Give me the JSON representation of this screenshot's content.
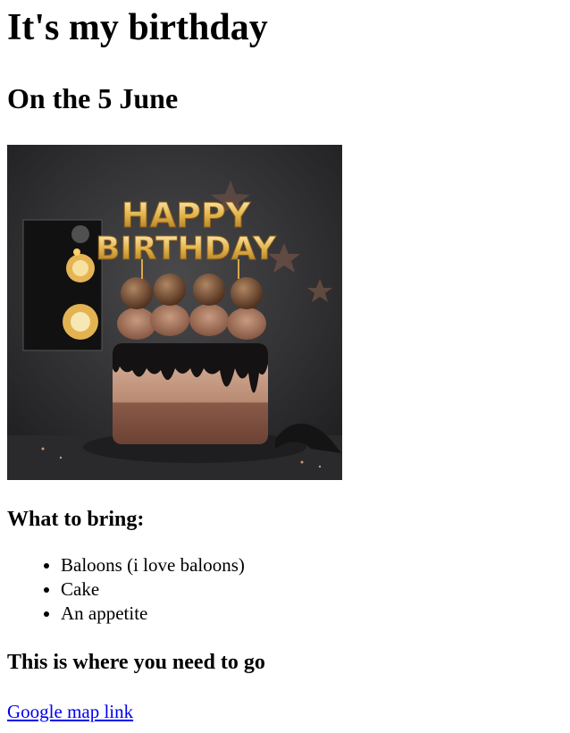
{
  "page": {
    "title": "It's my birthday",
    "date_heading": "On the 5 June"
  },
  "image": {
    "topper_line1": "HAPPY",
    "topper_line2": "BIRTHDAY"
  },
  "bring": {
    "heading": "What to bring:",
    "items": [
      "Baloons (i love baloons)",
      "Cake",
      "An appetite"
    ]
  },
  "location": {
    "heading": "This is where you need to go",
    "link_text": "Google map link"
  },
  "colors": {
    "link": "#0000ee",
    "text": "#000000"
  }
}
